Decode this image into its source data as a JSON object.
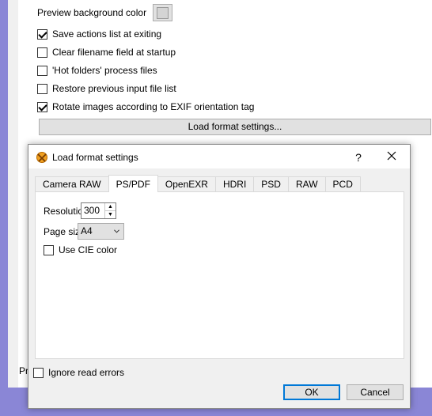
{
  "parent": {
    "preview_bg_label": "Preview background color",
    "options": [
      {
        "label": "Save actions list at exiting",
        "checked": true
      },
      {
        "label": "Clear filename field at startup",
        "checked": false
      },
      {
        "label": "'Hot folders' process files",
        "checked": false
      },
      {
        "label": "Restore previous input file list",
        "checked": false
      },
      {
        "label": "Rotate images according to EXIF orientation tag",
        "checked": true
      }
    ],
    "load_format_button": "Load format settings...",
    "peek_text": "Pr"
  },
  "dialog": {
    "title": "Load format settings",
    "help": "?",
    "tabs": [
      "Camera RAW",
      "PS/PDF",
      "OpenEXR",
      "HDRI",
      "PSD",
      "RAW",
      "PCD"
    ],
    "active_tab": "PS/PDF",
    "resolution_label": "Resolution",
    "resolution_value": "300",
    "page_size_label": "Page size",
    "page_size_value": "A4",
    "use_cie_label": "Use CIE color",
    "use_cie_checked": false,
    "ignore_errors_label": "Ignore read errors",
    "ignore_errors_checked": false,
    "ok_label": "OK",
    "cancel_label": "Cancel"
  }
}
